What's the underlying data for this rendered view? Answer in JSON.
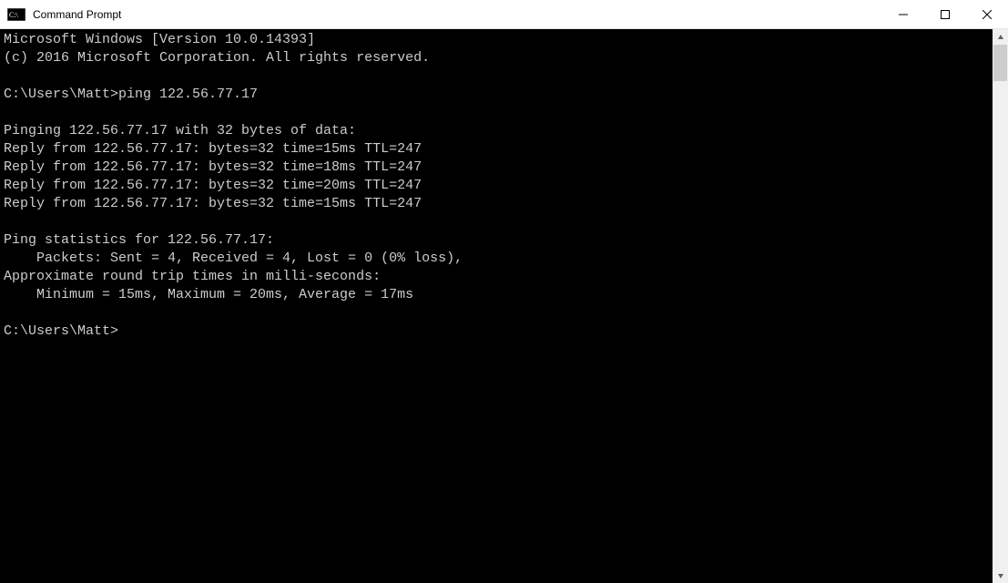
{
  "window": {
    "title": "Command Prompt"
  },
  "terminal": {
    "lines": [
      "Microsoft Windows [Version 10.0.14393]",
      "(c) 2016 Microsoft Corporation. All rights reserved.",
      "",
      "C:\\Users\\Matt>ping 122.56.77.17",
      "",
      "Pinging 122.56.77.17 with 32 bytes of data:",
      "Reply from 122.56.77.17: bytes=32 time=15ms TTL=247",
      "Reply from 122.56.77.17: bytes=32 time=18ms TTL=247",
      "Reply from 122.56.77.17: bytes=32 time=20ms TTL=247",
      "Reply from 122.56.77.17: bytes=32 time=15ms TTL=247",
      "",
      "Ping statistics for 122.56.77.17:",
      "    Packets: Sent = 4, Received = 4, Lost = 0 (0% loss),",
      "Approximate round trip times in milli-seconds:",
      "    Minimum = 15ms, Maximum = 20ms, Average = 17ms",
      "",
      "C:\\Users\\Matt>"
    ]
  }
}
